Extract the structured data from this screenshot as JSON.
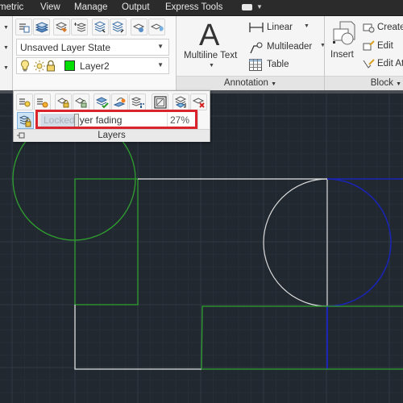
{
  "menubar": {
    "tabs": [
      "metric",
      "View",
      "Manage",
      "Output",
      "Express Tools"
    ],
    "extra_icon": "cloud-tab-icon"
  },
  "ribbon": {
    "layers": {
      "layer_state_value": "Unsaved Layer State",
      "current_layer": {
        "name": "Layer2",
        "color": "#00dd00",
        "icons": [
          "lightbulb-on-icon",
          "sun-icon",
          "padlock-icon"
        ]
      },
      "top_icons": [
        "layer-match-icon",
        "layer-properties-icon",
        "make-current-icon",
        "layer-walk-icon",
        "copy-objects-to-layer-icon",
        "layer-merge-icon",
        "layer-isolate-icon",
        "layer-unisolate-icon"
      ]
    },
    "annotation": {
      "title": "Annotation",
      "big_button": "Multiline Text",
      "big_glyph": "A",
      "items": [
        {
          "label": "Linear",
          "icon": "linear-dimension-icon",
          "has_dropdown": true
        },
        {
          "label": "Multileader",
          "icon": "multileader-icon",
          "has_dropdown": true
        },
        {
          "label": "Table",
          "icon": "table-icon",
          "has_dropdown": false
        }
      ]
    },
    "block": {
      "title": "Block",
      "big_button": "Insert",
      "items": [
        {
          "label": "Create",
          "icon": "create-block-icon"
        },
        {
          "label": "Edit",
          "icon": "edit-block-icon"
        },
        {
          "label": "Edit At",
          "icon": "edit-attributes-icon"
        }
      ]
    }
  },
  "layers_flyout": {
    "title": "Layers",
    "icons": [
      "layer-on-icon",
      "layer-thaw-icon",
      "layer-lock-icon",
      "layer-unlock-icon",
      "set-current-layer-icon",
      "layer-change-icon",
      "layer-walk-icon",
      "viewport-freeze-icon",
      "layer-move-icon",
      "layer-delete-icon"
    ],
    "locked_layer_fading": {
      "label_faded": "Locked l",
      "label_rest": "yer fading",
      "full_label": "Locked layer fading",
      "value_text": "27%",
      "value": 27,
      "enabled": true
    },
    "highlight_color": "#d9232d"
  },
  "drawing": {
    "background": "#212830",
    "line_colors": {
      "green": "#2fa12f",
      "white": "#e6e6e6",
      "blue": "#1a24b8"
    }
  }
}
